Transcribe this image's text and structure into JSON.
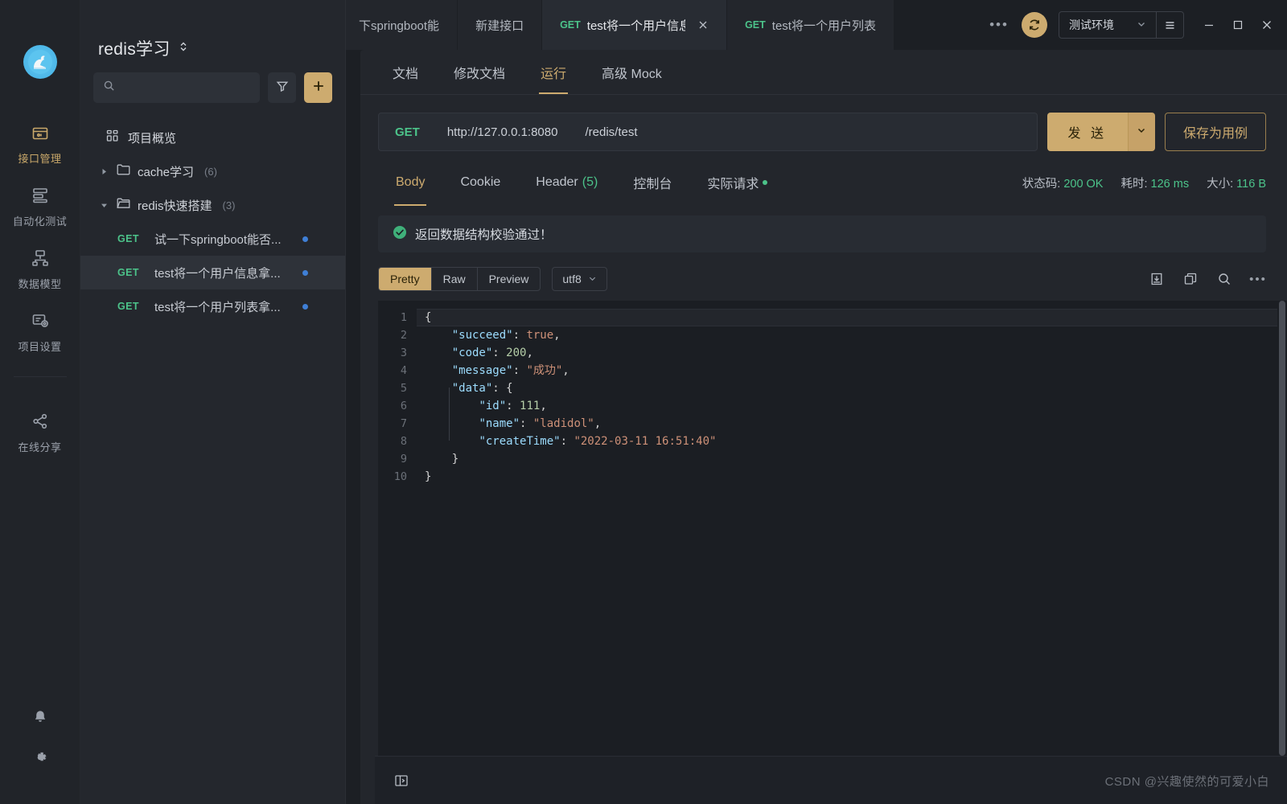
{
  "rail": {
    "logo_icon": "swan-logo-icon",
    "items": [
      {
        "label": "接口管理",
        "icon": "box-icon",
        "active": true
      },
      {
        "label": "自动化测试",
        "icon": "test-flow-icon",
        "active": false
      },
      {
        "label": "数据模型",
        "icon": "data-model-icon",
        "active": false
      },
      {
        "label": "项目设置",
        "icon": "project-settings-icon",
        "active": false
      },
      {
        "label": "在线分享",
        "icon": "share-icon",
        "active": false
      }
    ],
    "bottom": [
      {
        "name": "notification-bell-icon"
      },
      {
        "name": "settings-gear-icon"
      }
    ]
  },
  "sidebar": {
    "project_name": "redis学习",
    "project_switch_icon": "chevron-up-down-icon",
    "search": {
      "placeholder": "",
      "value": "",
      "icon": "search-icon"
    },
    "filter_icon": "filter-icon",
    "add_icon": "plus-icon",
    "overview": {
      "label": "项目概览",
      "icon": "grid-icon"
    },
    "folders": [
      {
        "label": "cache学习",
        "count": "(6)",
        "expanded": false
      },
      {
        "label": "redis快速搭建",
        "count": "(3)",
        "expanded": true
      }
    ],
    "apis": [
      {
        "method": "GET",
        "name": "试一下springboot能否...",
        "selected": false
      },
      {
        "method": "GET",
        "name": "test将一个用户信息拿...",
        "selected": true
      },
      {
        "method": "GET",
        "name": "test将一个用户列表拿...",
        "selected": false
      }
    ]
  },
  "tabbar": {
    "tabs": [
      {
        "method": "",
        "title": "下springboot能",
        "active": false,
        "closable": false
      },
      {
        "method": "",
        "title": "新建接口",
        "active": false,
        "closable": false
      },
      {
        "method": "GET",
        "title": "test将一个用户信息",
        "active": true,
        "closable": true
      },
      {
        "method": "GET",
        "title": "test将一个用户列表",
        "active": false,
        "closable": false
      }
    ],
    "more_icon": "more-horizontal-icon",
    "sync_icon": "sync-refresh-icon",
    "environment": "测试环境",
    "env_caret_icon": "chevron-down-icon",
    "env_menu_icon": "hamburger-menu-icon",
    "window": {
      "minimize_icon": "minimize-icon",
      "maximize_icon": "maximize-icon",
      "close_icon": "close-icon"
    }
  },
  "doc_tabs": [
    {
      "label": "文档",
      "active": false
    },
    {
      "label": "修改文档",
      "active": false
    },
    {
      "label": "运行",
      "active": true
    },
    {
      "label": "高级 Mock",
      "active": false
    }
  ],
  "request": {
    "method": "GET",
    "host": "http://127.0.0.1:8080",
    "path": "/redis/test",
    "send_label": "发 送",
    "send_caret_icon": "chevron-down-icon",
    "save_label": "保存为用例"
  },
  "response": {
    "tabs": [
      {
        "label": "Body",
        "active": true,
        "count": ""
      },
      {
        "label": "Cookie",
        "active": false,
        "count": ""
      },
      {
        "label": "Header",
        "active": false,
        "count": "(5)"
      },
      {
        "label": "控制台",
        "active": false,
        "count": ""
      },
      {
        "label": "实际请求",
        "active": false,
        "count": "",
        "dot": true
      }
    ],
    "meta": [
      {
        "label": "状态码:",
        "value": "200 OK"
      },
      {
        "label": "耗时:",
        "value": "126 ms"
      },
      {
        "label": "大小:",
        "value": "116 B"
      }
    ],
    "validation": {
      "icon": "check-circle-icon",
      "text": "返回数据结构校验通过！"
    },
    "format": {
      "segments": [
        {
          "label": "Pretty",
          "active": true
        },
        {
          "label": "Raw",
          "active": false
        },
        {
          "label": "Preview",
          "active": false
        }
      ],
      "encoding": "utf8",
      "encoding_caret_icon": "chevron-down-icon",
      "icons": [
        {
          "name": "download-icon"
        },
        {
          "name": "copy-icon"
        },
        {
          "name": "search-icon"
        },
        {
          "name": "more-horizontal-icon"
        }
      ]
    },
    "code": {
      "lines": [
        {
          "n": "1",
          "tokens": [
            {
              "t": "{",
              "c": "d"
            }
          ]
        },
        {
          "n": "2",
          "tokens": [
            {
              "t": "    ",
              "c": "d"
            },
            {
              "t": "\"succeed\"",
              "c": "p"
            },
            {
              "t": ": ",
              "c": "d"
            },
            {
              "t": "true",
              "c": "b"
            },
            {
              "t": ",",
              "c": "d"
            }
          ]
        },
        {
          "n": "3",
          "tokens": [
            {
              "t": "    ",
              "c": "d"
            },
            {
              "t": "\"code\"",
              "c": "p"
            },
            {
              "t": ": ",
              "c": "d"
            },
            {
              "t": "200",
              "c": "n"
            },
            {
              "t": ",",
              "c": "d"
            }
          ]
        },
        {
          "n": "4",
          "tokens": [
            {
              "t": "    ",
              "c": "d"
            },
            {
              "t": "\"message\"",
              "c": "p"
            },
            {
              "t": ": ",
              "c": "d"
            },
            {
              "t": "\"成功\"",
              "c": "s"
            },
            {
              "t": ",",
              "c": "d"
            }
          ]
        },
        {
          "n": "5",
          "tokens": [
            {
              "t": "    ",
              "c": "d"
            },
            {
              "t": "\"data\"",
              "c": "p"
            },
            {
              "t": ": {",
              "c": "d"
            }
          ]
        },
        {
          "n": "6",
          "tokens": [
            {
              "t": "        ",
              "c": "d"
            },
            {
              "t": "\"id\"",
              "c": "p"
            },
            {
              "t": ": ",
              "c": "d"
            },
            {
              "t": "111",
              "c": "n"
            },
            {
              "t": ",",
              "c": "d"
            }
          ]
        },
        {
          "n": "7",
          "tokens": [
            {
              "t": "        ",
              "c": "d"
            },
            {
              "t": "\"name\"",
              "c": "p"
            },
            {
              "t": ": ",
              "c": "d"
            },
            {
              "t": "\"ladidol\"",
              "c": "s"
            },
            {
              "t": ",",
              "c": "d"
            }
          ]
        },
        {
          "n": "8",
          "tokens": [
            {
              "t": "        ",
              "c": "d"
            },
            {
              "t": "\"createTime\"",
              "c": "p"
            },
            {
              "t": ": ",
              "c": "d"
            },
            {
              "t": "\"2022-03-11 16:51:40\"",
              "c": "s"
            }
          ]
        },
        {
          "n": "9",
          "tokens": [
            {
              "t": "    }",
              "c": "d"
            }
          ]
        },
        {
          "n": "10",
          "tokens": [
            {
              "t": "}",
              "c": "d"
            }
          ]
        }
      ]
    }
  },
  "bottombar": {
    "collapse_icon": "collapse-panel-icon"
  },
  "watermark": "CSDN @兴趣使然的可爱小白",
  "colors": {
    "accent": "#cdab6f",
    "method_get": "#4cc38a",
    "bg_app": "#1c1f24",
    "bg_panel": "#23262c",
    "bg_code": "#1b1e23",
    "status_ok": "#4cc38a",
    "api_dot": "#3f7fd6"
  }
}
